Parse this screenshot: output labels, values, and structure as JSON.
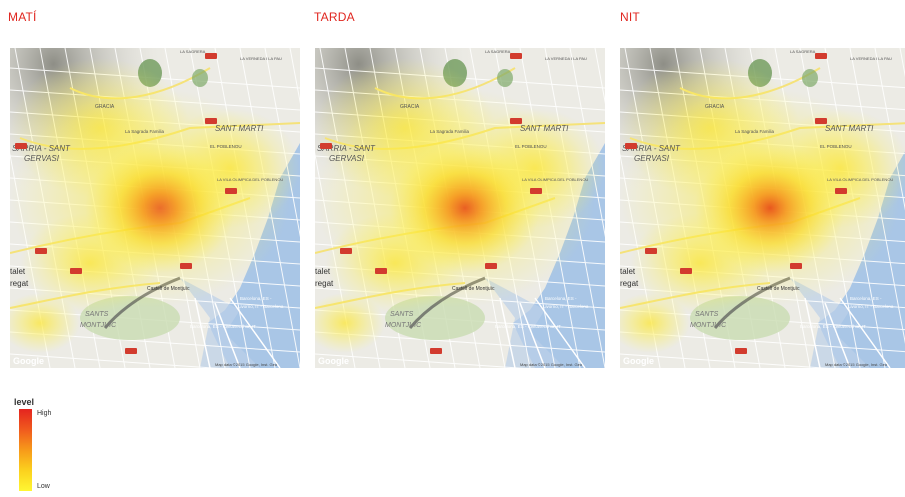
{
  "panels": [
    {
      "title": "MATÍ",
      "intensity": 0.85,
      "attribution": "Map data ©2015 Google, Inst. Geo"
    },
    {
      "title": "TARDA",
      "intensity": 0.95,
      "attribution": "Map data ©2015 Google, Inst. Geo"
    },
    {
      "title": "NIT",
      "intensity": 1.0,
      "attribution": "Map data ©2015 Google, Inst. Geo"
    }
  ],
  "map_labels": {
    "sarria": "SARRIA - SANT",
    "gervasi": "GERVASI",
    "sant_marti": "SANT MARTI",
    "gracia": "GRACIA",
    "sagrada": "La Sagrada Familia",
    "poblenou": "EL POBLENOU",
    "montjuic": "Castell de Montjuïc",
    "sants": "SANTS",
    "montjuic2": "MONTJUÏC",
    "talet": "talet",
    "regat": "regat",
    "barcelona": "Barcelona, ES -",
    "livorno": "Livorno, IT - Barcelona",
    "civitavecchia": "Barcelona, ES - Civitavecchia, IT",
    "google": "Google",
    "verneda": "LA VERNEDA I LA PAU",
    "sagrera": "LA SAGRERA",
    "vila": "LA VILA OLIMPICA DEL POBLENOU"
  },
  "legend": {
    "title": "level",
    "high": "High",
    "low": "Low",
    "colors": [
      "#e4241f",
      "#f05a1e",
      "#f79a1a",
      "#fbd11e",
      "#fff733"
    ]
  }
}
